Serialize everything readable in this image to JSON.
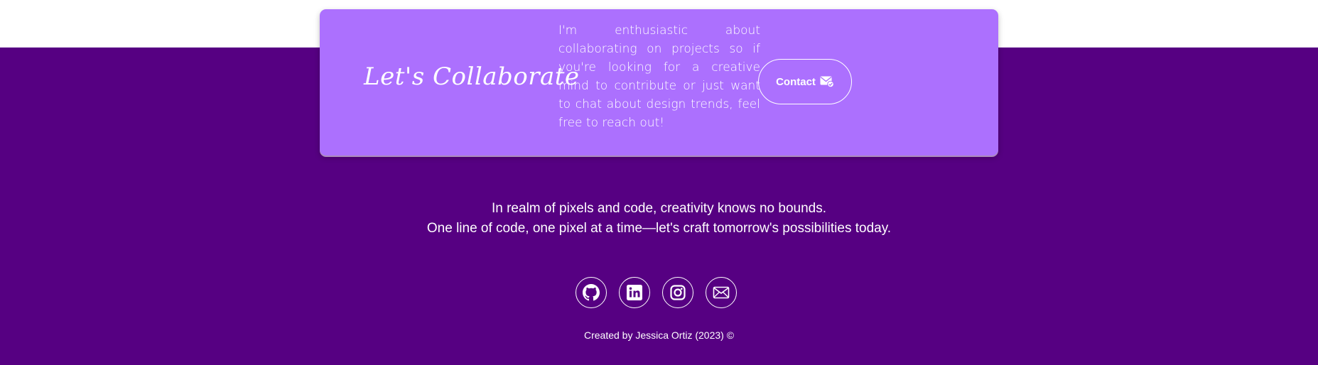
{
  "collaborate": {
    "title": "Let's Collaborate",
    "description": "I'm enthusiastic about collaborating on projects so if you're looking for a creative mind to contribute or just want to chat about design trends, feel free to reach out!",
    "contact_button": {
      "label": "Contact",
      "icon": "mail-check-icon"
    }
  },
  "footer": {
    "tagline_line1": "In realm of pixels and code, creativity knows no bounds.",
    "tagline_line2": "One line of code, one pixel at a time—let's craft tomorrow's possibilities today.",
    "social_links": [
      {
        "name": "GitHub",
        "icon": "github-icon"
      },
      {
        "name": "LinkedIn",
        "icon": "linkedin-icon"
      },
      {
        "name": "Instagram",
        "icon": "instagram-icon"
      },
      {
        "name": "Email",
        "icon": "envelope-icon"
      }
    ],
    "credit": "Created by Jessica Ortiz (2023) ©"
  },
  "colors": {
    "footer_background": "#560082",
    "card_background": "#ac70fe",
    "text": "#ffffff",
    "page_background": "#ffffff"
  }
}
